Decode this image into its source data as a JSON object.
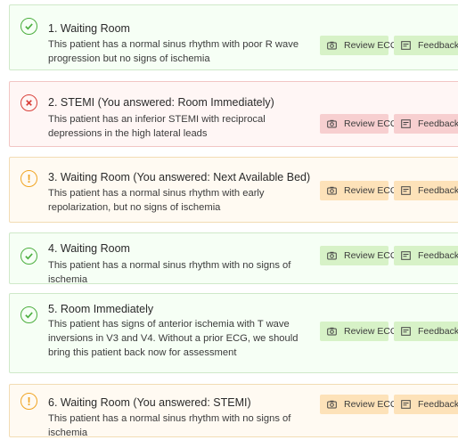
{
  "cards": [
    {
      "title": "1. Waiting Room",
      "description": "This patient has a normal sinus rhythm with poor R wave progression but no signs of ischemia",
      "status": "correct",
      "review_label": "Review ECG",
      "feedback_label": "Feedback"
    },
    {
      "title": "2. STEMI (You answered: Room Immediately)",
      "description": "This patient has an inferior STEMI with reciprocal depressions in the high lateral leads",
      "status": "incorrect",
      "review_label": "Review ECG",
      "feedback_label": "Feedback"
    },
    {
      "title": "3. Waiting Room (You answered: Next Available Bed)",
      "description": "This patient has a normal sinus rhythm with early repolarization, but no signs of ischemia",
      "status": "warning",
      "review_label": "Review ECG",
      "feedback_label": "Feedback"
    },
    {
      "title": "4. Waiting Room",
      "description": "This patient has a normal sinus rhythm with no signs of ischemia",
      "status": "correct",
      "review_label": "Review ECG",
      "feedback_label": "Feedback"
    },
    {
      "title": "5. Room Immediately",
      "description": "This patient has signs of anterior ischemia with T wave inversions in V3 and V4. Without a prior ECG, we should bring this patient back now for assessment",
      "status": "correct",
      "review_label": "Review ECG",
      "feedback_label": "Feedback"
    },
    {
      "title": "6. Waiting Room (You answered: STEMI)",
      "description": "This patient has a normal sinus rhythm with no signs of ischemia",
      "status": "warning",
      "review_label": "Review ECG",
      "feedback_label": "Feedback"
    }
  ],
  "icons": {
    "correct": "check-circle-icon",
    "incorrect": "x-circle-icon",
    "warning": "exclamation-circle-icon",
    "review": "camera-icon",
    "feedback": "message-icon"
  },
  "colors": {
    "correct": "#4cae3f",
    "incorrect": "#d9403a",
    "warning": "#f0a524"
  }
}
